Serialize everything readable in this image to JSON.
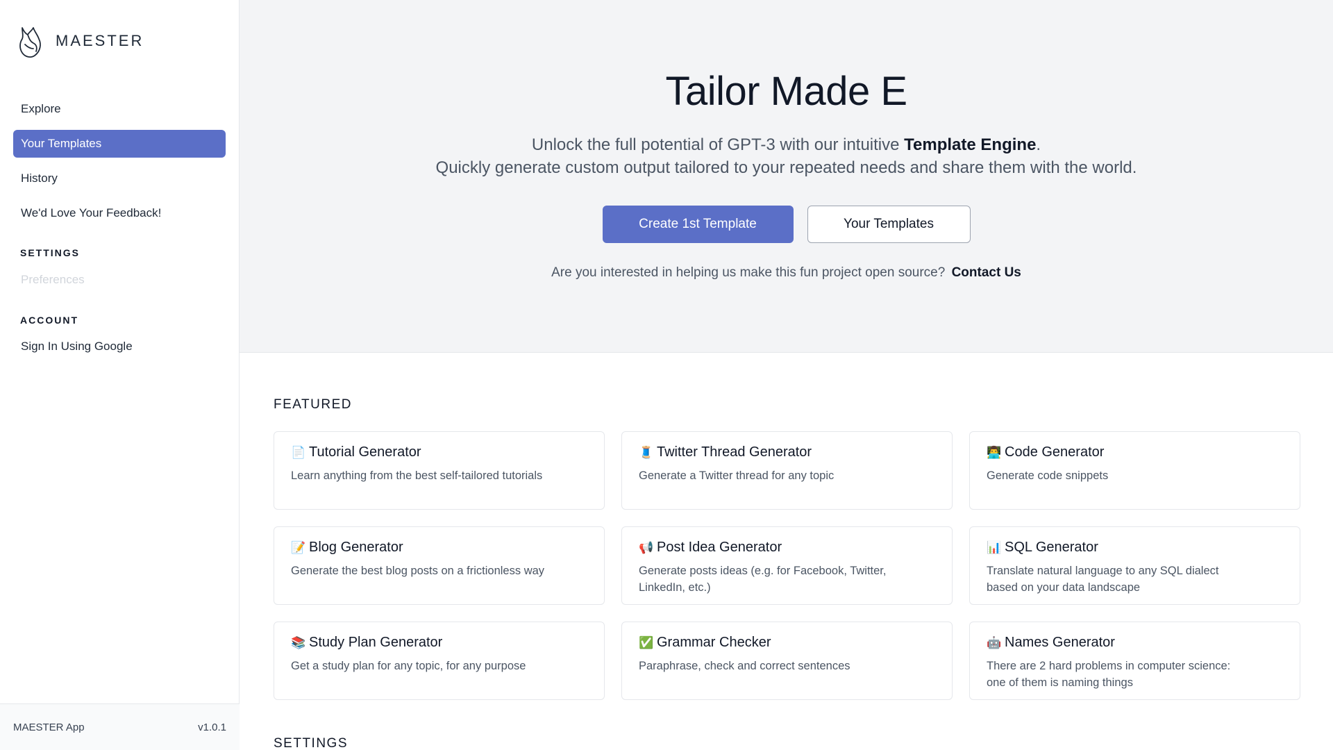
{
  "sidebar": {
    "brand": {
      "name": "MAESTER",
      "logo_icon": "fox-logo-icon"
    },
    "nav": [
      {
        "label": "Explore",
        "active": false
      },
      {
        "label": "Your Templates",
        "active": true
      },
      {
        "label": "History",
        "active": false
      },
      {
        "label": "We'd Love Your Feedback!",
        "active": false
      }
    ],
    "settings_heading": "SETTINGS",
    "preferences_label": "Preferences",
    "account_heading": "ACCOUNT",
    "signin_label": "Sign In Using Google",
    "footer": {
      "app_name": "MAESTER App",
      "version": "v1.0.1"
    }
  },
  "hero": {
    "title": "Tailor Made E",
    "subtitle_line1_prefix": "Unlock the full potential of GPT-3 with our intuitive ",
    "subtitle_line1_bold": "Template Engine",
    "subtitle_line1_suffix": ".",
    "subtitle_line2": "Quickly generate custom output tailored to your repeated needs and share them with the world.",
    "primary_button": "Create 1st Template",
    "secondary_button": "Your Templates",
    "contact_text": "Are you interested in helping us make this fun project open source?",
    "contact_link": "Contact Us"
  },
  "featured": {
    "title": "FEATURED",
    "cards": [
      {
        "emoji": "📄",
        "icon": "page-icon",
        "title": "Tutorial Generator",
        "desc": "Learn anything from the best self-tailored tutorials"
      },
      {
        "emoji": "🧵",
        "icon": "thread-spool-icon",
        "title": "Twitter Thread Generator",
        "desc": "Generate a Twitter thread for any topic"
      },
      {
        "emoji": "👨‍💻",
        "icon": "technologist-icon",
        "title": "Code Generator",
        "desc": "Generate code snippets"
      },
      {
        "emoji": "📝",
        "icon": "memo-icon",
        "title": "Blog Generator",
        "desc": "Generate the best blog posts on a frictionless way"
      },
      {
        "emoji": "📢",
        "icon": "megaphone-icon",
        "title": "Post Idea Generator",
        "desc": "Generate posts ideas (e.g. for Facebook, Twitter, LinkedIn, etc.)"
      },
      {
        "emoji": "📊",
        "icon": "bar-chart-icon",
        "title": "SQL Generator",
        "desc": "Translate natural language to any SQL dialect based on your data landscape"
      },
      {
        "emoji": "📚",
        "icon": "books-icon",
        "title": "Study Plan Generator",
        "desc": "Get a study plan for any topic, for any purpose"
      },
      {
        "emoji": "✅",
        "icon": "check-mark-icon",
        "title": "Grammar Checker",
        "desc": "Paraphrase, check and correct sentences"
      },
      {
        "emoji": "🤖",
        "icon": "robot-icon",
        "title": "Names Generator",
        "desc": "There are 2 hard problems in computer science: one of them is naming things"
      }
    ]
  },
  "settings_section": {
    "title": "SETTINGS"
  },
  "colors": {
    "accent": "#5b6fc7",
    "sidebar_bg": "#ffffff",
    "hero_bg": "#f3f4f6"
  }
}
